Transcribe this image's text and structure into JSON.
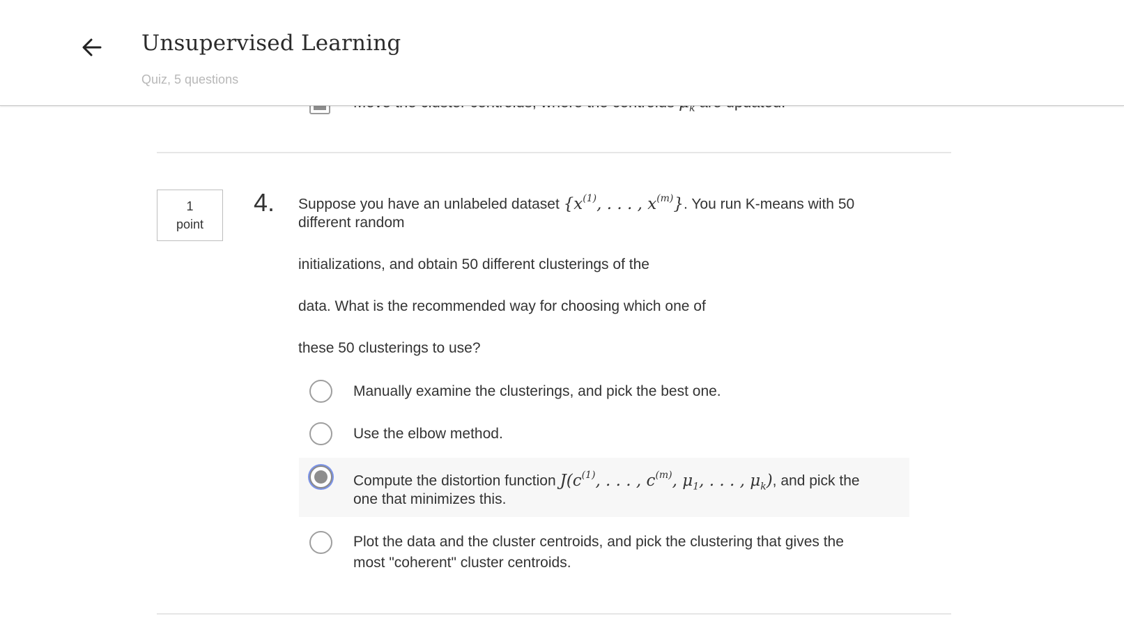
{
  "header": {
    "title": "Unsupervised Learning",
    "subtitle": "Quiz, 5 questions",
    "back_icon": "arrow-left-icon"
  },
  "previous_option": {
    "text_before": "Move the cluster centroids, where the centroids ",
    "math": "μ",
    "math_sub": "k",
    "text_after": " are updated."
  },
  "question": {
    "points_value": "1",
    "points_label": "point",
    "number": "4.",
    "line1_before": "Suppose you have an unlabeled dataset ",
    "line1_math": "{x",
    "line1_sup1": "(1)",
    "line1_math_mid": ", . . . , x",
    "line1_sup2": "(m)",
    "line1_math_end": "}",
    "line1_after": ". You run K-means with 50",
    "line2": "different random",
    "line3": "initializations, and obtain 50 different clusterings of the",
    "line4": "data. What is the recommended way for choosing which one of",
    "line5": "these 50 clusterings to use?"
  },
  "options": [
    {
      "text": "Manually examine the clusterings, and pick the best one.",
      "selected": false
    },
    {
      "text": "Use the elbow method.",
      "selected": false
    },
    {
      "text_before": "Compute the distortion function ",
      "math_a": "J(c",
      "math_sup1": "(1)",
      "math_b": ", . . . , c",
      "math_sup2": "(m)",
      "math_c": ", μ",
      "math_sub1": "1",
      "math_d": ", . . . , μ",
      "math_sub2": "k",
      "math_e": ")",
      "text_after": ", and pick the",
      "line2": "one that minimizes this.",
      "selected": true
    },
    {
      "line1": "Plot the data and the cluster centroids, and pick the clustering that gives the",
      "line2": "most \"coherent\" cluster centroids.",
      "selected": false
    }
  ],
  "colors": {
    "selected_ring": "#7c94e8",
    "radio_fill": "#8e8e8e",
    "selected_bg": "#f7f7f7"
  }
}
